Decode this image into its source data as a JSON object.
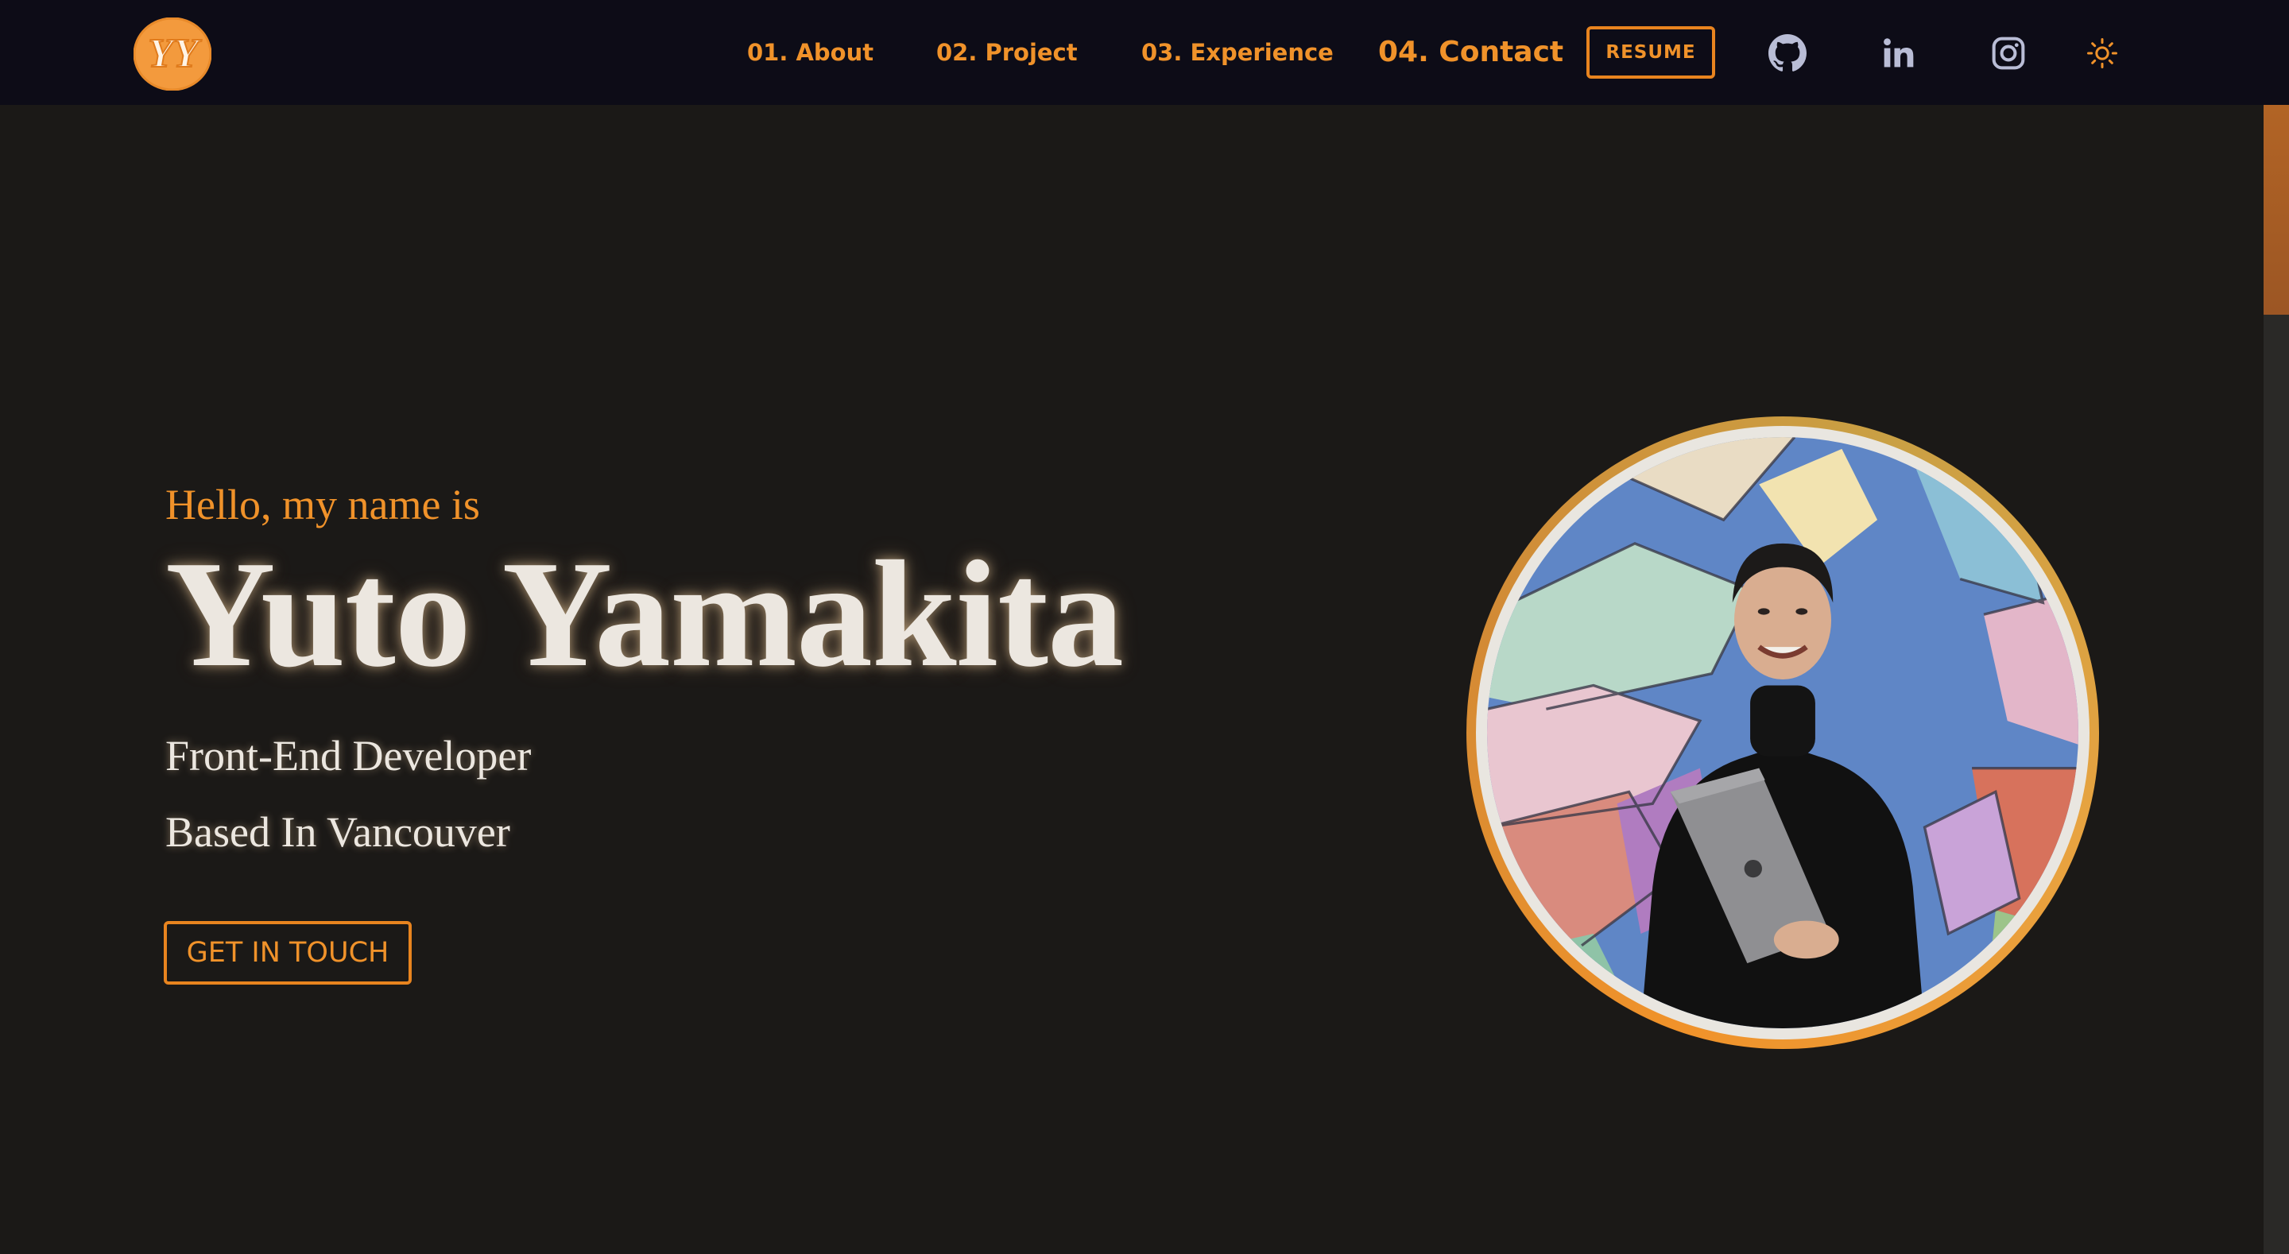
{
  "nav": {
    "logo_text": "YY",
    "links": [
      {
        "label": "01. About"
      },
      {
        "label": "02. Project"
      },
      {
        "label": "03. Experience"
      },
      {
        "label": "04. Contact"
      }
    ],
    "resume_label": "RESUME",
    "social": [
      {
        "icon": "github-icon"
      },
      {
        "icon": "linkedin-icon"
      },
      {
        "icon": "instagram-icon"
      }
    ],
    "theme_toggle_icon": "sun-icon"
  },
  "hero": {
    "greeting": "Hello, my name is",
    "name": "Yuto Yamakita",
    "role": "Front-End Developer",
    "location": "Based In Vancouver",
    "cta_label": "GET IN TOUCH"
  },
  "portrait": {
    "icon": "profile-photo"
  },
  "colors": {
    "accent": "#f0922a",
    "background": "#1b1917",
    "navbar": "#0d0c17",
    "text": "#ece7e0",
    "social_icon": "#b9bdd6"
  }
}
